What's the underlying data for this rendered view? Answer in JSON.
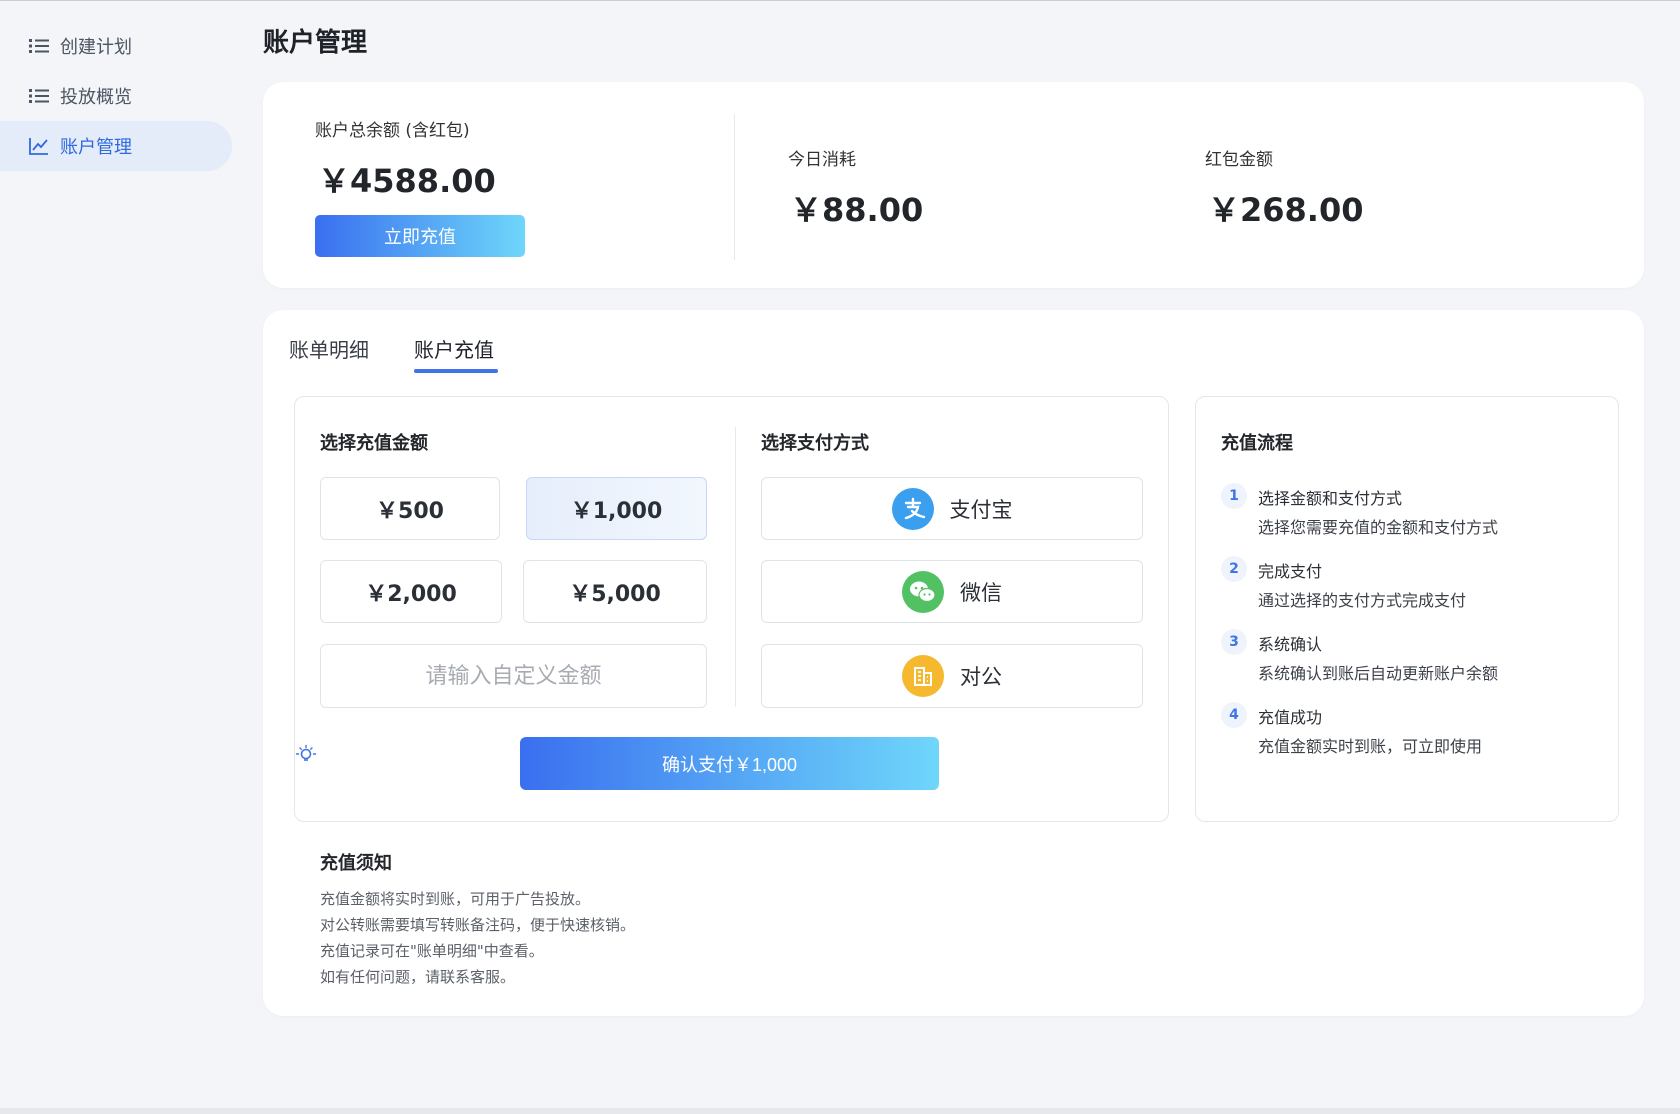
{
  "sidebar": {
    "items": [
      {
        "label": "创建计划",
        "icon": "list-icon"
      },
      {
        "label": "投放概览",
        "icon": "list-icon"
      },
      {
        "label": "账户管理",
        "icon": "line-chart-icon",
        "active": true
      }
    ]
  },
  "page": {
    "title": "账户管理"
  },
  "balance": {
    "total_label": "账户总余额 (含红包)",
    "total_value": "￥4588.00",
    "recharge_button": "立即充值",
    "today_label": "今日消耗",
    "today_value": "￥88.00",
    "redpacket_label": "红包金额",
    "redpacket_value": "￥268.00"
  },
  "tabs": [
    {
      "label": "账单明细",
      "active": false
    },
    {
      "label": "账户充值",
      "active": true
    }
  ],
  "recharge": {
    "amount_title": "选择充值金额",
    "amounts": [
      {
        "label": "￥500",
        "selected": false
      },
      {
        "label": "￥1,000",
        "selected": true
      },
      {
        "label": "￥2,000",
        "selected": false
      },
      {
        "label": "￥5,000",
        "selected": false
      }
    ],
    "custom_placeholder": "请输入自定义金额",
    "payment_title": "选择支付方式",
    "payments": [
      {
        "label": "支付宝",
        "icon": "alipay-icon",
        "color": "#3b9ff0"
      },
      {
        "label": "微信",
        "icon": "wechat-icon",
        "color": "#52c163"
      },
      {
        "label": "对公",
        "icon": "building-icon",
        "color": "#f5b82e"
      }
    ],
    "confirm_button": "确认支付￥1,000"
  },
  "process": {
    "title": "充值流程",
    "steps": [
      {
        "num": "1",
        "title": "选择金额和支付方式",
        "desc": "选择您需要充值的金额和支付方式"
      },
      {
        "num": "2",
        "title": "完成支付",
        "desc": "通过选择的支付方式完成支付"
      },
      {
        "num": "3",
        "title": "系统确认",
        "desc": "系统确认到账后自动更新账户余额"
      },
      {
        "num": "4",
        "title": "充值成功",
        "desc": "充值金额实时到账，可立即使用"
      }
    ]
  },
  "notice": {
    "title": "充值须知",
    "lines": [
      "充值金额将实时到账，可用于广告投放。",
      "对公转账需要填写转账备注码，便于快速核销。",
      "充值记录可在\"账单明细\"中查看。",
      "如有任何问题，请联系客服。"
    ]
  },
  "colors": {
    "accent": "#3f74e6",
    "active_nav_bg": "#e4ebf9"
  }
}
